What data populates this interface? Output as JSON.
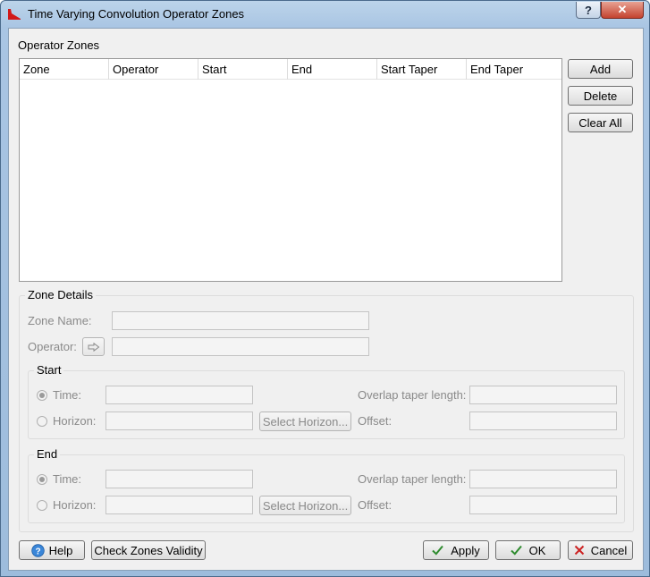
{
  "window": {
    "title": "Time Varying Convolution Operator Zones",
    "help_glyph": "?",
    "close_glyph": "✕"
  },
  "operator_zones": {
    "label": "Operator Zones",
    "columns": [
      "Zone",
      "Operator",
      "Start",
      "End",
      "Start Taper",
      "End Taper"
    ],
    "rows": [],
    "buttons": {
      "add": "Add",
      "delete": "Delete",
      "clear_all": "Clear All"
    }
  },
  "zone_details": {
    "title": "Zone Details",
    "zone_name_label": "Zone Name:",
    "zone_name_value": "",
    "operator_label": "Operator:",
    "operator_value": "",
    "start": {
      "title": "Start",
      "time_label": "Time:",
      "horizon_label": "Horizon:",
      "select_horizon": "Select Horizon...",
      "overlap_label": "Overlap taper length:",
      "offset_label": "Offset:",
      "time_selected": true
    },
    "end": {
      "title": "End",
      "time_label": "Time:",
      "horizon_label": "Horizon:",
      "select_horizon": "Select Horizon...",
      "overlap_label": "Overlap taper length:",
      "offset_label": "Offset:",
      "time_selected": true
    }
  },
  "footer": {
    "help": "Help",
    "check_zones": "Check Zones Validity",
    "apply": "Apply",
    "ok": "OK",
    "cancel": "Cancel"
  },
  "colors": {
    "apply_check": "#2e8b2e",
    "cancel_x": "#cc2222",
    "help_icon": "#3a86d8",
    "app_icon": "#d11a1a"
  }
}
